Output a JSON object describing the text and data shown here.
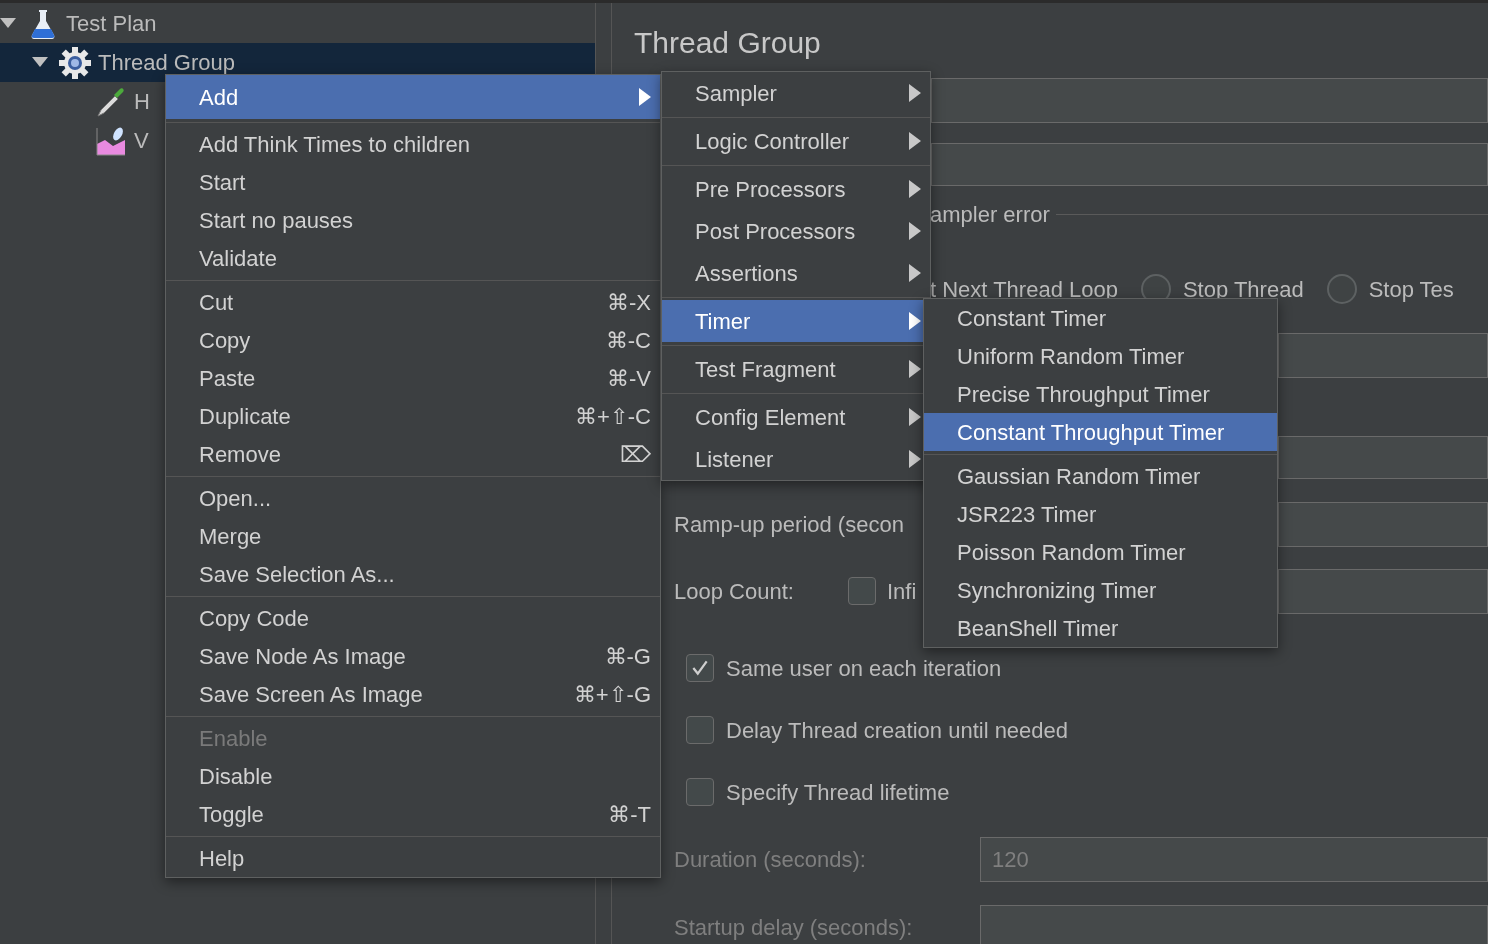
{
  "tree": [
    {
      "label": "Test Plan",
      "kind": "plan",
      "expanded": true,
      "selected": false,
      "children": [
        {
          "label": "Thread Group",
          "kind": "group",
          "expanded": true,
          "selected": true,
          "children": [
            {
              "label": "H",
              "kind": "sampler",
              "selected": false
            },
            {
              "label": "V",
              "kind": "listener",
              "selected": false
            }
          ]
        }
      ]
    }
  ],
  "panel": {
    "title": "Thread Group",
    "on_error": {
      "legend": "ampler error",
      "options": [
        {
          "label": "t Next Thread Loop"
        },
        {
          "label": "Stop Thread",
          "selected": false
        },
        {
          "label": "Stop Tes",
          "selected": false
        }
      ]
    },
    "ramp_up": {
      "label": "Ramp-up period (secon"
    },
    "loop_count": {
      "label": "Loop Count:",
      "infinite": {
        "label": "Infi",
        "checked": false
      }
    },
    "checkboxes": [
      {
        "label": "Same user on each iteration",
        "checked": true
      },
      {
        "label": "Delay Thread creation until needed",
        "checked": false
      },
      {
        "label": "Specify Thread lifetime",
        "checked": false
      }
    ],
    "duration": {
      "label": "Duration (seconds):",
      "value": "120",
      "disabled": true
    },
    "startup_delay": {
      "label": "Startup delay (seconds):",
      "disabled": true
    }
  },
  "context_menu": {
    "groups": [
      {
        "items": [
          {
            "label": "Add",
            "submenu": true,
            "selected": true
          }
        ]
      },
      {
        "items": [
          {
            "label": "Add Think Times to children"
          },
          {
            "label": "Start"
          },
          {
            "label": "Start no pauses"
          },
          {
            "label": "Validate"
          }
        ]
      },
      {
        "items": [
          {
            "label": "Cut",
            "shortcut": "⌘-X"
          },
          {
            "label": "Copy",
            "shortcut": "⌘-C"
          },
          {
            "label": "Paste",
            "shortcut": "⌘-V"
          },
          {
            "label": "Duplicate",
            "shortcut": "⌘+⇧-C"
          },
          {
            "label": "Remove",
            "shortcut": "⌦"
          }
        ]
      },
      {
        "items": [
          {
            "label": "Open..."
          },
          {
            "label": "Merge"
          },
          {
            "label": "Save Selection As..."
          }
        ]
      },
      {
        "items": [
          {
            "label": "Copy Code"
          },
          {
            "label": "Save Node As Image",
            "shortcut": "⌘-G"
          },
          {
            "label": "Save Screen As Image",
            "shortcut": "⌘+⇧-G"
          }
        ]
      },
      {
        "items": [
          {
            "label": "Enable",
            "disabled": true
          },
          {
            "label": "Disable"
          },
          {
            "label": "Toggle",
            "shortcut": "⌘-T"
          }
        ]
      },
      {
        "items": [
          {
            "label": "Help"
          }
        ]
      }
    ]
  },
  "add_submenu": {
    "groups": [
      {
        "items": [
          {
            "label": "Sampler",
            "submenu": true,
            "selected": false
          }
        ]
      },
      {
        "items": [
          {
            "label": "Logic Controller",
            "submenu": true,
            "selected": false
          }
        ]
      },
      {
        "items": [
          {
            "label": "Pre Processors",
            "submenu": true,
            "selected": false
          },
          {
            "label": "Post Processors",
            "submenu": true,
            "selected": false
          },
          {
            "label": "Assertions",
            "submenu": true,
            "selected": false
          }
        ]
      },
      {
        "items": [
          {
            "label": "Timer",
            "submenu": true,
            "selected": true
          }
        ]
      },
      {
        "items": [
          {
            "label": "Test Fragment",
            "submenu": true,
            "selected": false
          }
        ]
      },
      {
        "items": [
          {
            "label": "Config Element",
            "submenu": true,
            "selected": false
          },
          {
            "label": "Listener",
            "submenu": true,
            "selected": false
          }
        ]
      }
    ]
  },
  "timer_submenu": {
    "groups": [
      {
        "items": [
          {
            "label": "Constant Timer",
            "selected": false
          },
          {
            "label": "Uniform Random Timer",
            "selected": false
          },
          {
            "label": "Precise Throughput Timer",
            "selected": false
          },
          {
            "label": "Constant Throughput Timer",
            "selected": true
          }
        ]
      },
      {
        "items": [
          {
            "label": "Gaussian Random Timer",
            "selected": false
          },
          {
            "label": "JSR223 Timer",
            "selected": false
          },
          {
            "label": "Poisson Random Timer",
            "selected": false
          },
          {
            "label": "Synchronizing Timer",
            "selected": false
          },
          {
            "label": "BeanShell Timer",
            "selected": false
          }
        ]
      }
    ]
  }
}
